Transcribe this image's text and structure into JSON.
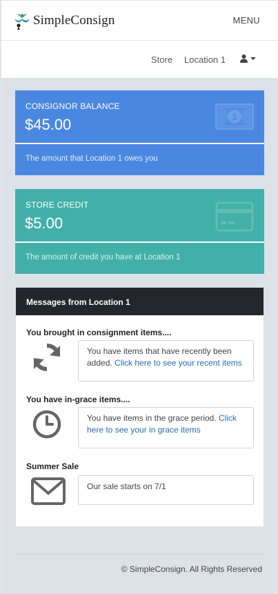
{
  "header": {
    "brand_name": "SimpleConsign",
    "menu_label": "MENU"
  },
  "subnav": {
    "store_label": "Store",
    "location_label": "Location 1"
  },
  "cards": {
    "balance": {
      "label": "CONSIGNOR BALANCE",
      "value": "$45.00",
      "description": "The amount that Location 1 owes you",
      "icon": "money-bill-icon",
      "color": "#4a87e0"
    },
    "credit": {
      "label": "STORE CREDIT",
      "value": "$5.00",
      "description": "The amount of credit you have at Location 1",
      "icon": "credit-card-icon",
      "color": "#42b0a8"
    }
  },
  "messages": {
    "title": "Messages from Location 1",
    "items": [
      {
        "title": "You brought in consignment items....",
        "text": "You have items that have recently been added. ",
        "link": "Click here to see your recent items",
        "icon": "refresh-icon"
      },
      {
        "title": "You have in-grace items....",
        "text": "You have items in the grace period. ",
        "link": "Click here to see your in grace items",
        "icon": "clock-icon"
      },
      {
        "title": "Summer Sale",
        "text": "Our sale starts on 7/1",
        "link": "",
        "icon": "envelope-icon"
      }
    ]
  },
  "footer": {
    "copyright": "© SimpleConsign. All Rights Reserved"
  },
  "colors": {
    "page_bg": "#dde2e9",
    "messages_header": "#24262b",
    "link": "#2a6ab2"
  }
}
